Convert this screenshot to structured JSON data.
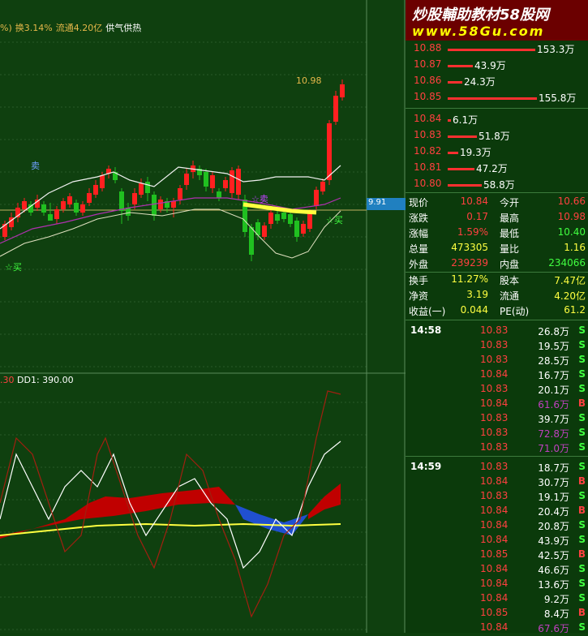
{
  "main_chart": {
    "info_prefix": "%)",
    "turnover": "换3.14%",
    "float": "流通4.20亿",
    "indicator": "供气供热",
    "sell_label": "卖",
    "buy_label_1": "☆买",
    "buy_label_2": "☆买",
    "buy_label_3": "☆卖",
    "high_mark": "10.98",
    "price_tag": "9.91",
    "colors": {
      "up": "#ff2020",
      "down": "#20c020",
      "ma": "#b030b0",
      "band": "#f0f0f0",
      "yellow": "#ffff40"
    }
  },
  "sub_chart": {
    "prefix": ".30",
    "label": "DD1: 390.00",
    "colors": {
      "fill_red": "#c00000",
      "fill_blue": "#2050d0",
      "line_dark_red": "#a02010",
      "line_white": "#ffffff",
      "line_yellow": "#ffff40"
    }
  },
  "watermark": {
    "line1": "炒股輔助教材58股网",
    "line2": "www.58Gu.com"
  },
  "order_book": {
    "asks": [
      {
        "price": "10.88",
        "volume": "153.3万",
        "fill": 0.98
      },
      {
        "price": "10.87",
        "volume": "43.9万",
        "fill": 0.28
      },
      {
        "price": "10.86",
        "volume": "24.3万",
        "fill": 0.16
      },
      {
        "price": "10.85",
        "volume": "155.8万",
        "fill": 1.0
      }
    ],
    "bids": [
      {
        "price": "10.84",
        "volume": "6.1万",
        "fill": 0.04
      },
      {
        "price": "10.83",
        "volume": "51.8万",
        "fill": 0.33
      },
      {
        "price": "10.82",
        "volume": "19.3万",
        "fill": 0.12
      },
      {
        "price": "10.81",
        "volume": "47.2万",
        "fill": 0.3
      },
      {
        "price": "10.80",
        "volume": "58.8万",
        "fill": 0.38
      }
    ]
  },
  "quote": {
    "rows": [
      {
        "l1": "现价",
        "v1": "10.84",
        "c1": "#ff4040",
        "l2": "今开",
        "v2": "10.66",
        "c2": "#ff4040"
      },
      {
        "l1": "涨跌",
        "v1": "0.17",
        "c1": "#ff4040",
        "l2": "最高",
        "v2": "10.98",
        "c2": "#ff4040"
      },
      {
        "l1": "涨幅",
        "v1": "1.59%",
        "c1": "#ff4040",
        "l2": "最低",
        "v2": "10.40",
        "c2": "#40ff40"
      },
      {
        "l1": "总量",
        "v1": "473305",
        "c1": "#ffff40",
        "l2": "量比",
        "v2": "1.16",
        "c2": "#ffff40"
      },
      {
        "l1": "外盘",
        "v1": "239239",
        "c1": "#ff4040",
        "l2": "内盘",
        "v2": "234066",
        "c2": "#40ff40"
      },
      {
        "l1": "换手",
        "v1": "11.27%",
        "c1": "#ffff40",
        "l2": "股本",
        "v2": "7.47亿",
        "c2": "#ffff40"
      },
      {
        "l1": "净资",
        "v1": "3.19",
        "c1": "#ffff40",
        "l2": "流通",
        "v2": "4.20亿",
        "c2": "#ffff40"
      },
      {
        "l1": "收益(一)",
        "v1": "0.044",
        "c1": "#ffff40",
        "l2": "PE(动)",
        "v2": "61.2",
        "c2": "#ffff40"
      }
    ]
  },
  "ticks": {
    "groups": [
      {
        "time": "14:58",
        "rows": [
          {
            "p": "10.83",
            "v": "26.8万",
            "vc": "#ffffff",
            "s": "S"
          },
          {
            "p": "10.83",
            "v": "19.5万",
            "vc": "#ffffff",
            "s": "S"
          },
          {
            "p": "10.83",
            "v": "28.5万",
            "vc": "#ffffff",
            "s": "S"
          },
          {
            "p": "10.84",
            "v": "16.7万",
            "vc": "#ffffff",
            "s": "S"
          },
          {
            "p": "10.83",
            "v": "20.1万",
            "vc": "#ffffff",
            "s": "S"
          },
          {
            "p": "10.84",
            "v": "61.6万",
            "vc": "#c040c0",
            "s": "B"
          },
          {
            "p": "10.83",
            "v": "39.7万",
            "vc": "#ffffff",
            "s": "S"
          },
          {
            "p": "10.83",
            "v": "72.8万",
            "vc": "#c040c0",
            "s": "S"
          },
          {
            "p": "10.83",
            "v": "71.0万",
            "vc": "#c040c0",
            "s": "S"
          }
        ]
      },
      {
        "time": "14:59",
        "rows": [
          {
            "p": "10.83",
            "v": "18.7万",
            "vc": "#ffffff",
            "s": "S"
          },
          {
            "p": "10.84",
            "v": "30.7万",
            "vc": "#ffffff",
            "s": "B"
          },
          {
            "p": "10.83",
            "v": "19.1万",
            "vc": "#ffffff",
            "s": "S"
          },
          {
            "p": "10.84",
            "v": "20.4万",
            "vc": "#ffffff",
            "s": "B"
          },
          {
            "p": "10.84",
            "v": "20.8万",
            "vc": "#ffffff",
            "s": "S"
          },
          {
            "p": "10.84",
            "v": "43.9万",
            "vc": "#ffffff",
            "s": "S"
          },
          {
            "p": "10.85",
            "v": "42.5万",
            "vc": "#ffffff",
            "s": "B"
          },
          {
            "p": "10.84",
            "v": "46.6万",
            "vc": "#ffffff",
            "s": "S"
          },
          {
            "p": "10.84",
            "v": "13.6万",
            "vc": "#ffffff",
            "s": "S"
          },
          {
            "p": "10.84",
            "v": "9.2万",
            "vc": "#ffffff",
            "s": "S"
          },
          {
            "p": "10.85",
            "v": "8.4万",
            "vc": "#ffffff",
            "s": "B"
          },
          {
            "p": "10.84",
            "v": "67.6万",
            "vc": "#c040c0",
            "s": "S"
          }
        ]
      }
    ]
  }
}
